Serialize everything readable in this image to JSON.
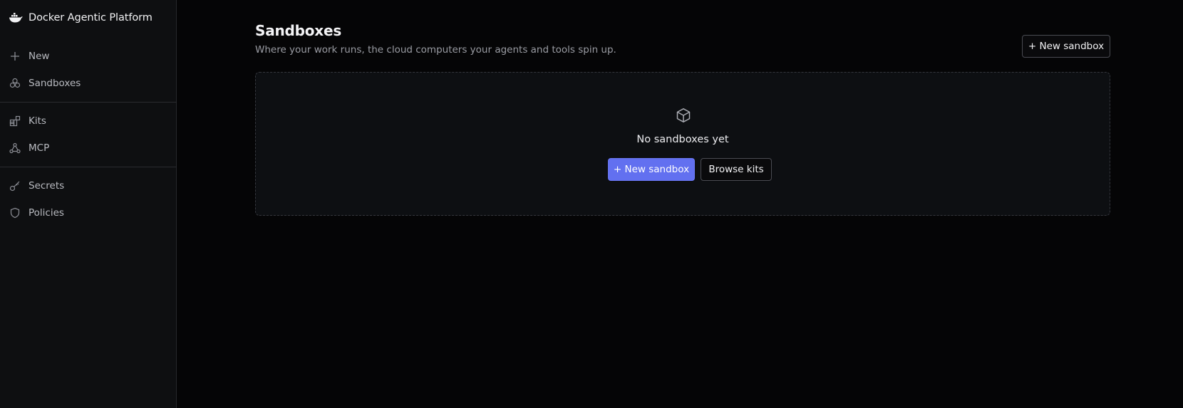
{
  "app": {
    "title": "Docker Agentic Platform",
    "logo_icon": "docker-whale-icon"
  },
  "sidebar": {
    "groups": [
      [
        {
          "label": "New",
          "icon": "plus-icon"
        },
        {
          "label": "Sandboxes",
          "icon": "sandboxes-icon"
        }
      ],
      [
        {
          "label": "Kits",
          "icon": "kits-icon"
        },
        {
          "label": "MCP",
          "icon": "mcp-icon"
        }
      ],
      [
        {
          "label": "Secrets",
          "icon": "key-icon"
        },
        {
          "label": "Policies",
          "icon": "shield-icon"
        }
      ]
    ]
  },
  "main": {
    "title": "Sandboxes",
    "subtitle": "Where your work runs, the cloud computers your agents and tools spin up.",
    "header_button": "+ New sandbox",
    "empty_state": {
      "icon": "box-icon",
      "message": "No sandboxes yet",
      "primary_button": "+ New sandbox",
      "secondary_button": "Browse kits"
    }
  },
  "colors": {
    "background": "#050506",
    "sidebar": "#0e0f11",
    "accent": "#6270f0",
    "panel": "#0d0f12"
  }
}
